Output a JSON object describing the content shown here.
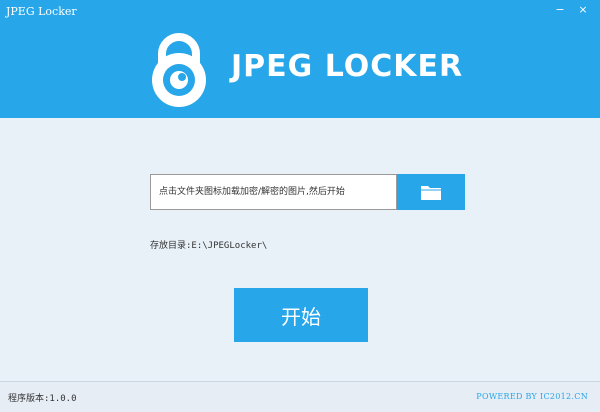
{
  "window": {
    "title": "JPEG Locker",
    "minimize_glyph": "−",
    "close_glyph": "×"
  },
  "header": {
    "app_name": "JPEG LOCKER",
    "logo_icon": "padlock-icon"
  },
  "file_picker": {
    "placeholder": "点击文件夹图标加载加密/解密的图片,然后开始",
    "value": "",
    "folder_icon": "folder-icon"
  },
  "save_dir": {
    "label": "存放目录:",
    "path": "E:\\JPEGLocker\\"
  },
  "start_button": {
    "label": "开始"
  },
  "footer": {
    "version_label": "程序版本:",
    "version": "1.0.0",
    "powered": "POWERED BY IC2012.CN"
  },
  "colors": {
    "accent": "#27a6ea",
    "background": "#e8f0f8",
    "text": "#333333"
  }
}
